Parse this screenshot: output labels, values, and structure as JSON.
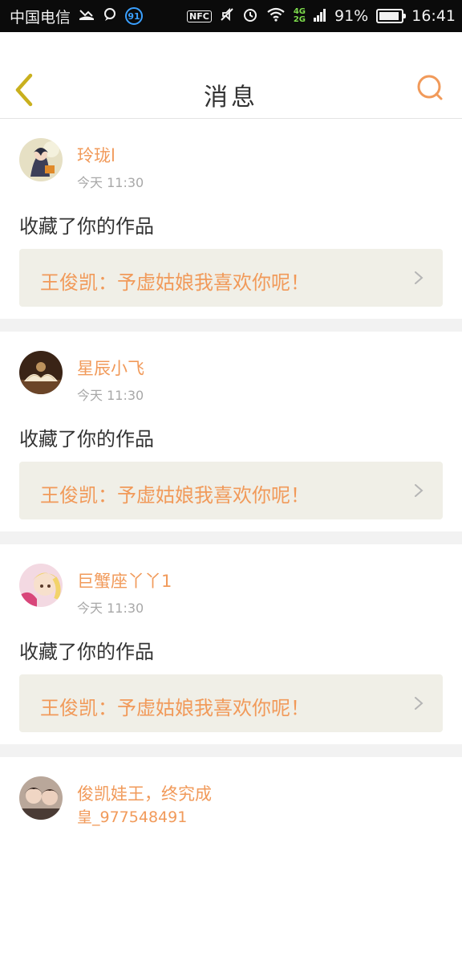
{
  "status_bar": {
    "carrier": "中国电信",
    "notif_badge": "91",
    "nfc": "NFC",
    "net_4g": "4G",
    "net_2g": "2G",
    "battery": "91%",
    "battery_level": 0.91,
    "time": "16:41",
    "icons": [
      "missed-call-icon",
      "chat-bubble-icon",
      "nfc-icon",
      "mute-icon",
      "alarm-icon",
      "wifi-icon",
      "signal-icon",
      "battery-icon"
    ]
  },
  "header": {
    "title": "消息",
    "back_icon": "chevron-left-icon",
    "search_icon": "search-icon"
  },
  "colors": {
    "accent": "#f19a5a",
    "back_icon": "#c9b01e",
    "work_box_bg": "#f0efe7",
    "divider": "#f2f2f2"
  },
  "messages": [
    {
      "username": "玲珑l",
      "time": "今天   11:30",
      "action": "收藏了你的作品",
      "work": "王俊凯：予虚姑娘我喜欢你呢！"
    },
    {
      "username": "星辰小飞",
      "time": "今天   11:30",
      "action": "收藏了你的作品",
      "work": "王俊凯：予虚姑娘我喜欢你呢！"
    },
    {
      "username": "巨蟹座丫丫1",
      "time": "今天   11:30",
      "action": "收藏了你的作品",
      "work": "王俊凯：予虚姑娘我喜欢你呢！"
    },
    {
      "username": "俊凯娃王，终究成",
      "time": "皇_977548491",
      "action": "",
      "work": ""
    }
  ]
}
